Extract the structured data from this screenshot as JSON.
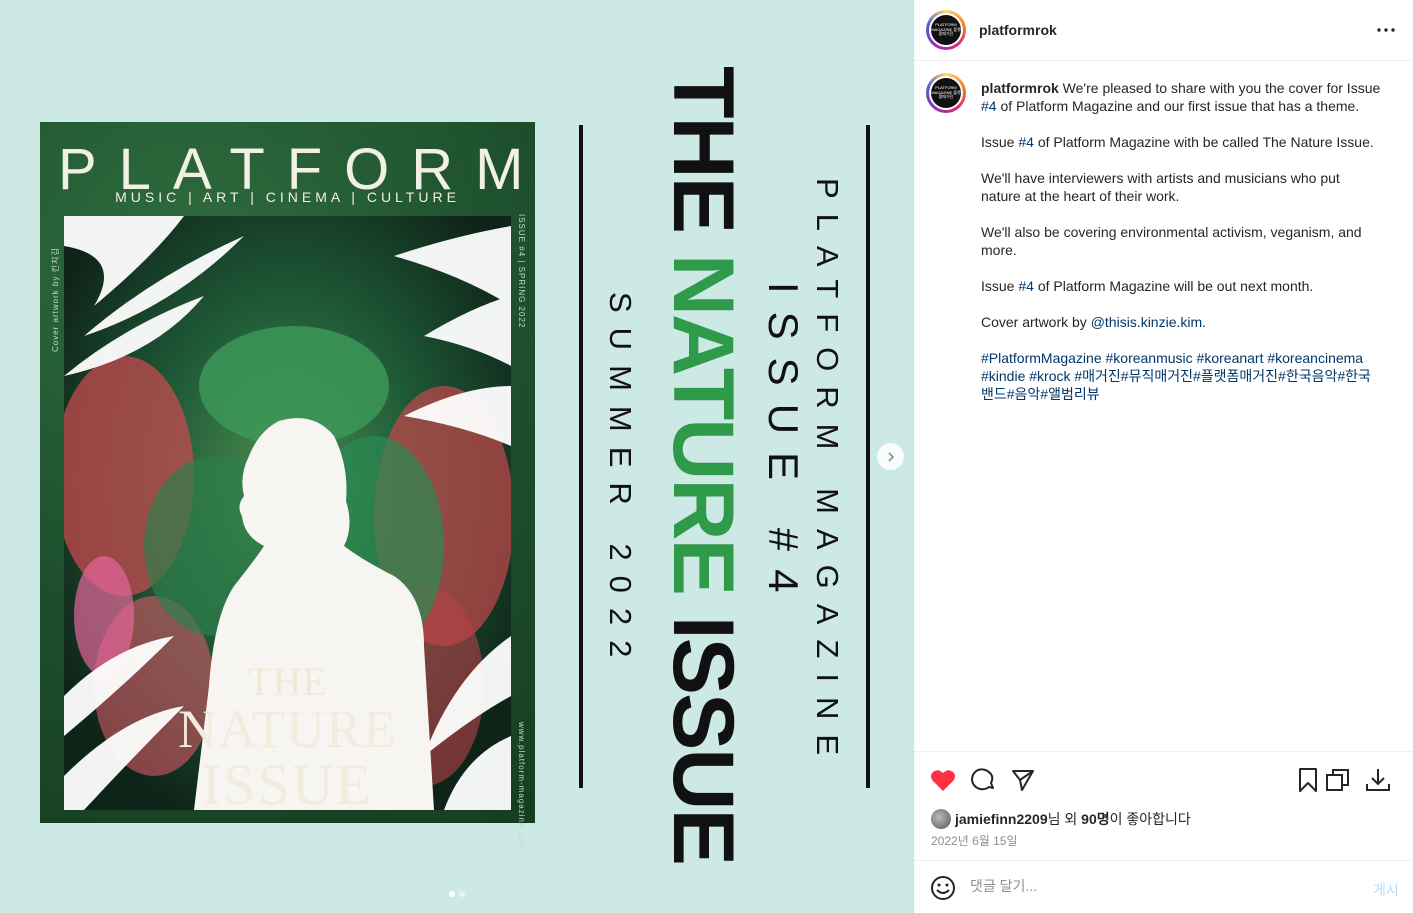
{
  "media": {
    "cover": {
      "title": "PLATFORM",
      "subtitle": "MUSIC | ART | CINEMA | CULTURE",
      "side_left": "Cover artwork by 킨지김",
      "side_right_top": "ISSUE #4 | SPRING 2022",
      "side_right_bottom": "www.platform-magazine.com",
      "issue_line1": "THE",
      "issue_line2": "NATURE",
      "issue_line3": "ISSUE"
    },
    "vertical": {
      "summer": "SUMMER 2022",
      "title_the": "THE ",
      "title_nature": "NATURE",
      "title_issue": " ISSUE",
      "issue_number": "ISSUE #4",
      "magazine": "PLATFORM MAGAZINE"
    },
    "next_icon": "chevron-right-icon",
    "slide_count": 2,
    "active_slide": 1
  },
  "header": {
    "username": "platformrok",
    "avatar_text": "PLATFORM MAGAZINE 플랫폼매거진",
    "more_icon": "more-horizontal-icon"
  },
  "caption": {
    "username": "platformrok",
    "p1_text": " We're pleased to share with you the cover for Issue ",
    "p1_tag": "#4",
    "p1_rest": " of Platform Magazine and our first issue that has a theme.",
    "p2_text": "Issue ",
    "p2_tag": "#4",
    "p2_rest": " of Platform Magazine with be called The Nature Issue.",
    "p3": "We'll have interviewers with artists and musicians who put nature at the heart of their work.",
    "p4": "We'll also be covering environmental activism, veganism, and more.",
    "p5_text": "Issue ",
    "p5_tag": "#4",
    "p5_rest": " of Platform Magazine will be out next month.",
    "p6_text": "Cover artwork by ",
    "p6_mention": "@thisis.kinzie.kim",
    "p6_rest": ".",
    "hashtags": "#PlatformMagazine #koreanmusic #koreanart #koreancinema #kindie #krock #매거진#뮤직매거진#플랫폼매거진#한국음악#한국밴드#음악#앨범리뷰"
  },
  "actions": {
    "like_icon": "heart-filled-icon",
    "comment_icon": "comment-icon",
    "share_icon": "send-icon",
    "save_icon": "bookmark-icon",
    "copy_icon": "copy-icon",
    "download_icon": "download-icon",
    "like_color": "#ff3040"
  },
  "likes": {
    "user": "jamiefinn2209",
    "middle": "님 외 ",
    "count": "90명",
    "suffix": "이 좋아합니다"
  },
  "date": "2022년 6월 15일",
  "comment": {
    "placeholder": "댓글 달기...",
    "post_label": "게시"
  }
}
